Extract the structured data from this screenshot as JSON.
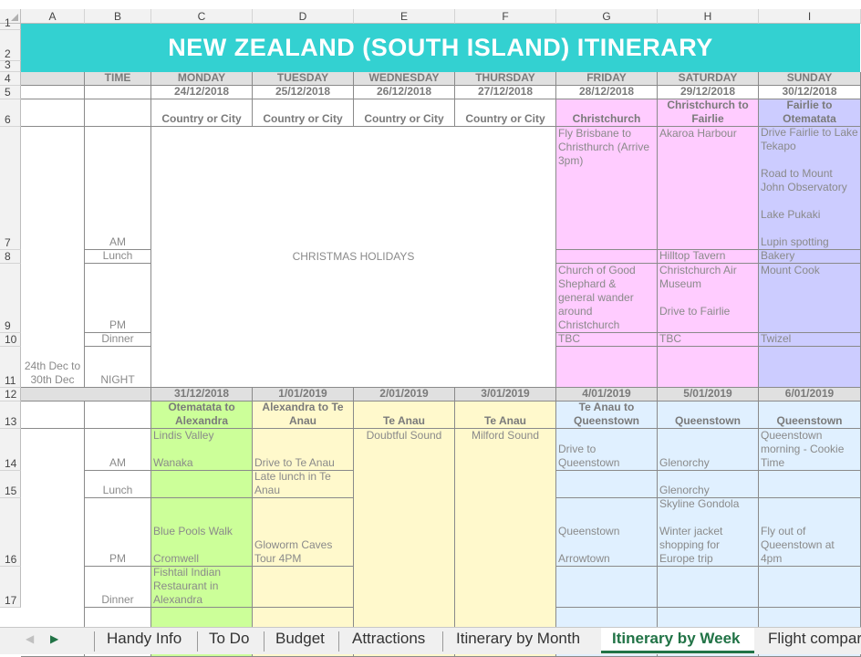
{
  "columns": [
    "A",
    "B",
    "C",
    "D",
    "E",
    "F",
    "G",
    "H",
    "I"
  ],
  "rows": [
    "1",
    "2",
    "3",
    "4",
    "5",
    "6",
    "7",
    "8",
    "9",
    "10",
    "11",
    "12",
    "13",
    "14",
    "15",
    "16",
    "17"
  ],
  "title": "NEW ZEALAND (SOUTH ISLAND) ITINERARY",
  "colors": {
    "title_bg": "#33d1d1",
    "pink": "#ffccff",
    "lavender": "#ccccff",
    "green": "#ccff99",
    "yellow": "#fff9cc",
    "blue": "#e0f0ff",
    "header_gray": "#e0e0e0",
    "active_tab": "#217346"
  },
  "header": {
    "time": "TIME",
    "days": [
      "MONDAY",
      "TUESDAY",
      "WEDNESDAY",
      "THURSDAY",
      "FRIDAY",
      "SATURDAY",
      "SUNDAY"
    ]
  },
  "week1": {
    "range": "24th Dec to 30th Dec",
    "dates": [
      "24/12/2018",
      "25/12/2018",
      "26/12/2018",
      "27/12/2018",
      "28/12/2018",
      "29/12/2018",
      "30/12/2018"
    ],
    "locations": [
      "Country or City",
      "Country or City",
      "Country or City",
      "Country or City",
      "Christchurch",
      "Christchurch to Fairlie",
      "Fairlie to Otematata"
    ],
    "times": [
      "AM",
      "Lunch",
      "PM",
      "Dinner",
      "NIGHT"
    ],
    "christmas": "CHRISTMAS HOLIDAYS",
    "friday": {
      "am": "Fly Brisbane to Christhurch (Arrive 3pm)",
      "pm": "Church of Good Shephard & general wander around Christchurch",
      "dinner": "TBC"
    },
    "saturday": {
      "am": "Akaroa Harbour",
      "lunch": "Hilltop Tavern",
      "pm": "Christchurch Air Museum\n\nDrive to Fairlie",
      "dinner": "TBC"
    },
    "sunday": {
      "am": "Drive Fairlie to Lake Tekapo\n\nRoad to Mount John Observatory\n\nLake Pukaki\n\nLupin spotting",
      "lunch": "Bakery",
      "pm": "Mount Cook",
      "dinner": "Twizel"
    }
  },
  "week2": {
    "dates": [
      "31/12/2018",
      "1/01/2019",
      "2/01/2019",
      "3/01/2019",
      "4/01/2019",
      "5/01/2019",
      "6/01/2019"
    ],
    "locations": [
      "Otematata to Alexandra",
      "Alexandra to Te Anau",
      "Te Anau",
      "Te Anau",
      "Te Anau to Queenstown",
      "Queenstown",
      "Queenstown"
    ],
    "times": [
      "AM",
      "Lunch",
      "PM",
      "Dinner"
    ],
    "monday": {
      "am": "Lindis Valley\n\nWanaka",
      "pm": "Blue Pools Walk\n\nCromwell",
      "dinner": "Fishtail Indian Restaurant in Alexandra"
    },
    "tuesday": {
      "am": "Drive to Te Anau",
      "lunch": "Late lunch in Te Anau",
      "pm": "Gloworm Caves Tour 4PM"
    },
    "wednesday": {
      "all": "Doubtful Sound"
    },
    "thursday": {
      "all": "Milford Sound"
    },
    "friday": {
      "am": "Drive to Queenstown",
      "pm": "Queenstown\n\nArrowtown"
    },
    "saturday": {
      "am": "Glenorchy",
      "lunch": "Glenorchy",
      "pm": "Skyline Gondola\n\nWinter jacket shopping for Europe trip"
    },
    "sunday": {
      "am": "Queenstown morning - Cookie Time",
      "pm": "Fly out of Queenstown at 4pm"
    }
  },
  "tabs": [
    "Handy Info",
    "To Do",
    "Budget",
    "Attractions",
    "Itinerary by Month",
    "Itinerary by Week",
    "Flight compar"
  ],
  "active_tab": "Itinerary by Week"
}
